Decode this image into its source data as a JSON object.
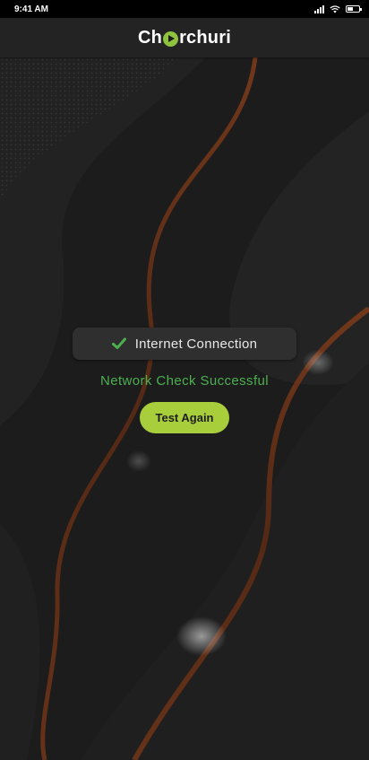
{
  "status_bar": {
    "time": "9:41 AM",
    "signal_icon": "signal-bars-icon",
    "wifi_icon": "wifi-icon",
    "battery_icon": "battery-icon",
    "battery_level": 0.5
  },
  "app_bar": {
    "logo_part1": "Ch",
    "logo_icon": "play-circle-icon",
    "logo_part2": "rchuri"
  },
  "connection": {
    "icon": "checkmark-icon",
    "label": "Internet Connection",
    "status": "Network Check Successful"
  },
  "actions": {
    "test_again_label": "Test Again"
  },
  "colors": {
    "accent": "#a8cf3b",
    "success": "#4cb050",
    "brand_green": "#8fc23f",
    "background": "#1b1b1b",
    "wave": "#6e3418"
  }
}
